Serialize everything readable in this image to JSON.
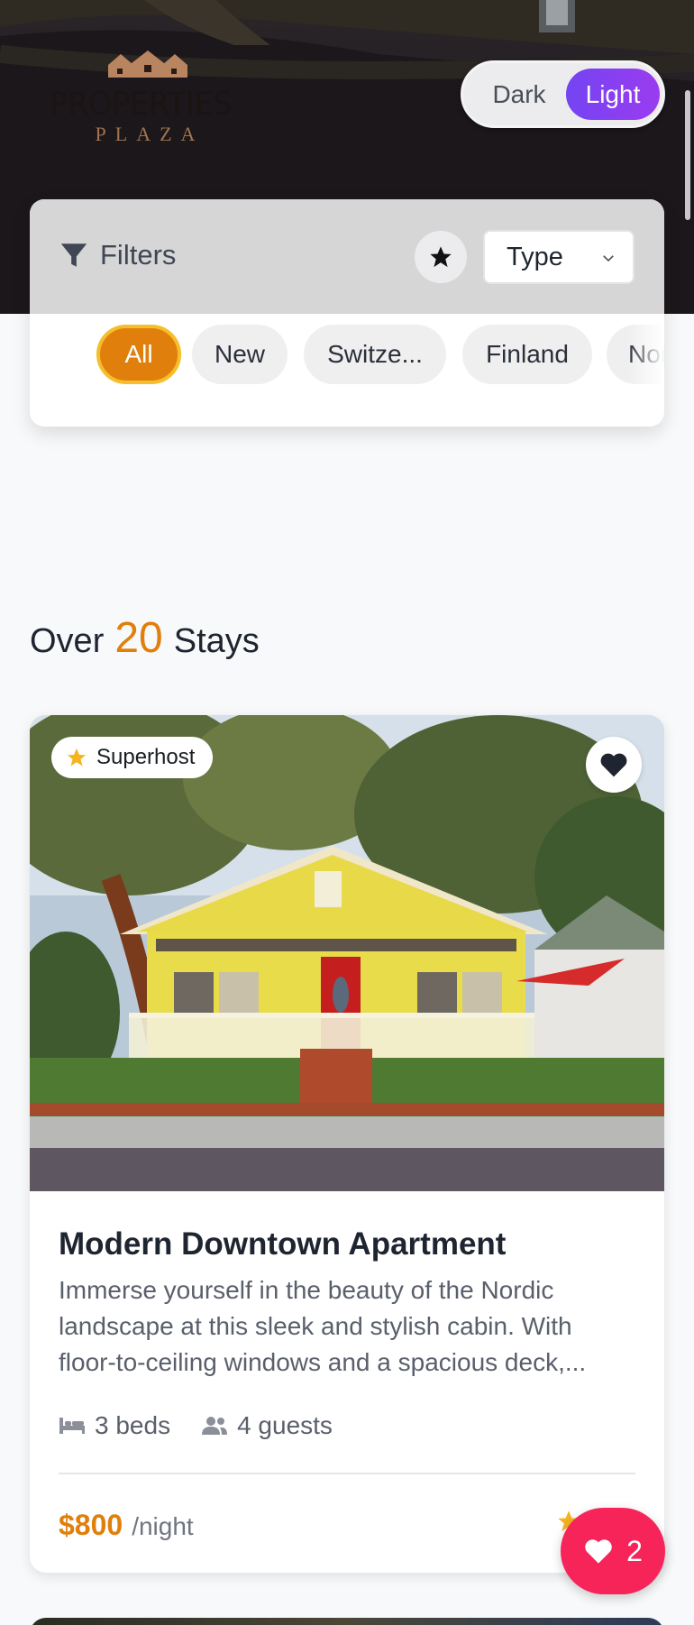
{
  "brand": {
    "title": "PROPERTIES",
    "subtitle": "PLAZA"
  },
  "theme_toggle": {
    "dark_label": "Dark",
    "light_label": "Light",
    "selected": "Light"
  },
  "filters": {
    "title": "Filters",
    "type_select": "Type",
    "pills": [
      {
        "label": "All",
        "active": true
      },
      {
        "label": "New",
        "active": false
      },
      {
        "label": "Switze...",
        "active": false
      },
      {
        "label": "Finland",
        "active": false
      },
      {
        "label": "Nor",
        "active": false
      }
    ]
  },
  "stays_heading": {
    "prefix": "Over",
    "count": "20",
    "suffix": "Stays"
  },
  "card": {
    "badge": "Superhost",
    "title": "Modern Downtown Apartment",
    "description": "Immerse yourself in the beauty of the Nordic landscape at this sleek and stylish cabin. With floor-to-ceiling windows and a spacious deck,...",
    "beds": "3 beds",
    "guests": "4 guests",
    "price": "$800",
    "price_unit": "/night"
  },
  "favorites_fab": {
    "count": "2"
  },
  "colors": {
    "accent": "#e07f0c",
    "toggle_active": "#8040f2",
    "fab": "#f7245a"
  }
}
